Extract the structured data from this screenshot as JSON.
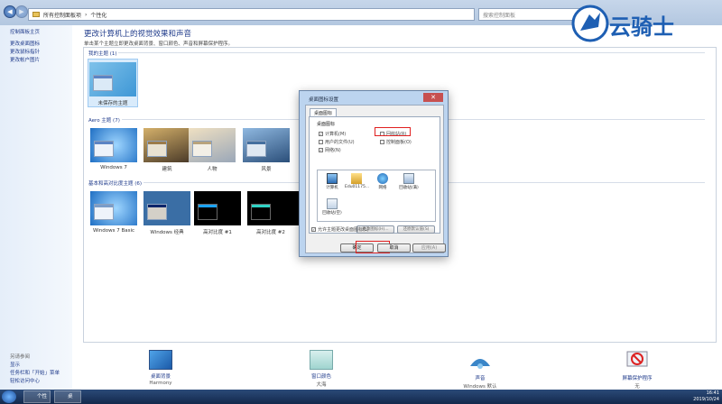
{
  "address": {
    "root": "所有控制面板项",
    "current": "个性化"
  },
  "search": {
    "placeholder": "搜索控制面板"
  },
  "sidebar": {
    "home": "控制面板主页",
    "links": [
      "更改桌面图标",
      "更改鼠标指针",
      "更改帐户图片"
    ],
    "see_also_title": "另请参阅",
    "see_also": [
      "显示",
      "任务栏和「开始」菜单",
      "轻松访问中心"
    ]
  },
  "main": {
    "title": "更改计算机上的视觉效果和声音",
    "subtitle": "单击某个主题立即更改桌面背景、窗口颜色、声音和屏幕保护程序。"
  },
  "groups": {
    "my_themes": "我的主题 (1)",
    "aero": "Aero 主题 (7)",
    "basic": "基本和高对比度主题 (6)"
  },
  "themes": {
    "unsaved": "未保存的主题",
    "aero": [
      "Windows 7",
      "建筑",
      "人物",
      "风景"
    ],
    "basic": [
      "Windows 7 Basic",
      "Windows 经典",
      "高对比度 #1",
      "高对比度 #2"
    ]
  },
  "bottom": {
    "desktop_bg": {
      "label": "桌面背景",
      "value": "Harmony"
    },
    "window_color": {
      "label": "窗口颜色",
      "value": "大海"
    },
    "sound": {
      "label": "声音",
      "value": "Windows 默认"
    },
    "screensaver": {
      "label": "屏幕保护程序",
      "value": "无"
    }
  },
  "dialog": {
    "title": "桌面图标设置",
    "tab": "桌面图标",
    "fieldset": "桌面图标",
    "checks": {
      "computer": "计算机(M)",
      "user_files": "用户的文件(U)",
      "network": "网络(N)",
      "recycle": "回收站(R)",
      "control_panel": "控制面板(O)"
    },
    "icons": [
      "计算机",
      "Edu01175...",
      "网络",
      "回收站(满)",
      "回收站(空)"
    ],
    "change_icon": "更改图标(H)...",
    "restore_default": "还原默认值(S)",
    "allow_themes": "允许主题更改桌面图标(L)",
    "ok": "确定",
    "cancel": "取消",
    "apply": "应用(A)"
  },
  "taskbar": {
    "tasks": [
      "个性化",
      "桌面..."
    ],
    "time": "16:41",
    "date": "2019/10/24"
  },
  "watermark": "云骑士",
  "colors": {
    "accent": "#1e3a8a",
    "highlight": "#e02020",
    "sidebar": "#e5eef9"
  }
}
